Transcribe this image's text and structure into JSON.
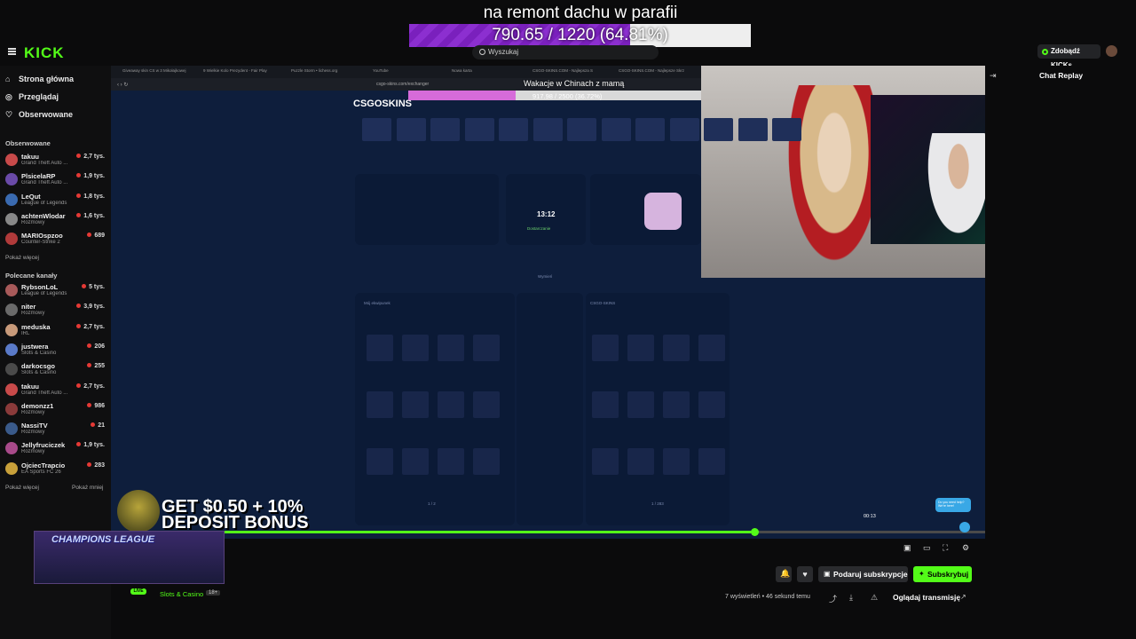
{
  "goal": {
    "title": "na remont dachu w parafii",
    "progress_text": "790.65 / 1220 (64.81%)",
    "fraction": 0.648
  },
  "header": {
    "logo": "KICK",
    "search_placeholder": "Wyszukaj",
    "kicks_button": "Zdobądź KICKs"
  },
  "sidebar": {
    "nav": [
      {
        "icon": "home-icon",
        "glyph": "⌂",
        "label": "Strona główna"
      },
      {
        "icon": "compass-icon",
        "glyph": "◎",
        "label": "Przeglądaj"
      },
      {
        "icon": "heart-icon",
        "glyph": "♡",
        "label": "Obserwowane"
      }
    ],
    "followed_title": "Obserwowane",
    "followed": [
      {
        "name": "takuu",
        "game": "Grand Theft Auto ...",
        "viewers": "2,7 tys.",
        "color": "#c84a4a"
      },
      {
        "name": "PlsicelaRP",
        "game": "Grand Theft Auto ...",
        "viewers": "1,9 tys.",
        "color": "#6a4aa8"
      },
      {
        "name": "LeQut",
        "game": "League of Legends",
        "viewers": "1,8 tys.",
        "color": "#3a6ab0"
      },
      {
        "name": "achtenWlodar",
        "game": "Rozmowy",
        "viewers": "1,6 tys.",
        "color": "#888"
      },
      {
        "name": "MARIOspzoo",
        "game": "Counter-Strike 2",
        "viewers": "689",
        "color": "#b03a3a"
      }
    ],
    "followed_more": "Pokaż więcej",
    "recommended_title": "Polecane kanały",
    "recommended": [
      {
        "name": "RybsonLoL",
        "game": "League of Legends",
        "viewers": "5 tys.",
        "color": "#a85a5a"
      },
      {
        "name": "niter",
        "game": "Rozmowy",
        "viewers": "3,9 tys.",
        "color": "#6a6a6a"
      },
      {
        "name": "meduska",
        "game": "IRL",
        "viewers": "2,7 tys.",
        "color": "#c89a7a"
      },
      {
        "name": "justwera",
        "game": "Slots & Casino",
        "viewers": "206",
        "color": "#5a7ac8"
      },
      {
        "name": "darkocsgo",
        "game": "Slots & Casino",
        "viewers": "255",
        "color": "#4a4a4a"
      },
      {
        "name": "takuu",
        "game": "Grand Theft Auto ...",
        "viewers": "2,7 tys.",
        "color": "#c84a4a"
      },
      {
        "name": "demonzz1",
        "game": "Rozmowy",
        "viewers": "986",
        "color": "#8a3a3a"
      },
      {
        "name": "NassiTV",
        "game": "Rozmowy",
        "viewers": "21",
        "color": "#3a5a8a"
      },
      {
        "name": "Jellyfruciczek",
        "game": "Rozmowy",
        "viewers": "1,9 tys.",
        "color": "#a84a8a"
      },
      {
        "name": "OjciecTrapcio",
        "game": "EA Sports FC 26",
        "viewers": "283",
        "color": "#c8a03a"
      }
    ],
    "show_more": "Pokaż więcej",
    "show_less": "Pokaż mniej"
  },
  "browser": {
    "tabs": [
      "Giveaway skin CS w 3 Mikołajkowej",
      "9 Wielkie Kolo Prezydent - Fair Play",
      "Puzzle Storm • lichess.org",
      "YouTube",
      "Nowa karta",
      "CSGO-SKINS.COM - Najlepsza S",
      "CSGO-SKINS.COM - Najlepsze Skrz"
    ],
    "url": "csgo-skins.com/exchanger"
  },
  "site": {
    "logo": "CSGOSKINS",
    "timer": "13:12",
    "status": "Dostarczanie",
    "my_eq": "Mój ekwipunek",
    "site_eq": "CSGO-SKINS",
    "exchange": "Wymień",
    "page_left": "1 / 2",
    "page_right": "1 / 283"
  },
  "overlay_goal": {
    "title": "Wakacje w Chinach z mamą",
    "progress_text": "917.98 / 2500 (36.72%)",
    "fraction": 0.367
  },
  "chat": {
    "title": "Chat Replay"
  },
  "player": {
    "time": "00:13",
    "progress": 0.732,
    "help": "Do you need help? We're here!"
  },
  "ad": {
    "line1": "GET $0.50 + 10%",
    "line2": "DEPOSIT BONUS",
    "banner": "CHAMPIONS LEAGUE"
  },
  "stream": {
    "live": "LIVE",
    "category": "Slots & Casino",
    "age": "18+",
    "views": "7 wyświetleń • 46 sekund temu"
  },
  "actions": {
    "gift": "Podaruj subskrypcje",
    "subscribe": "Subskrybuj",
    "watch": "Oglądaj transmisję"
  },
  "colors": {
    "accent": "#53fc18",
    "goal_fill": "#8c2fd0",
    "live_dot": "#e53935"
  }
}
